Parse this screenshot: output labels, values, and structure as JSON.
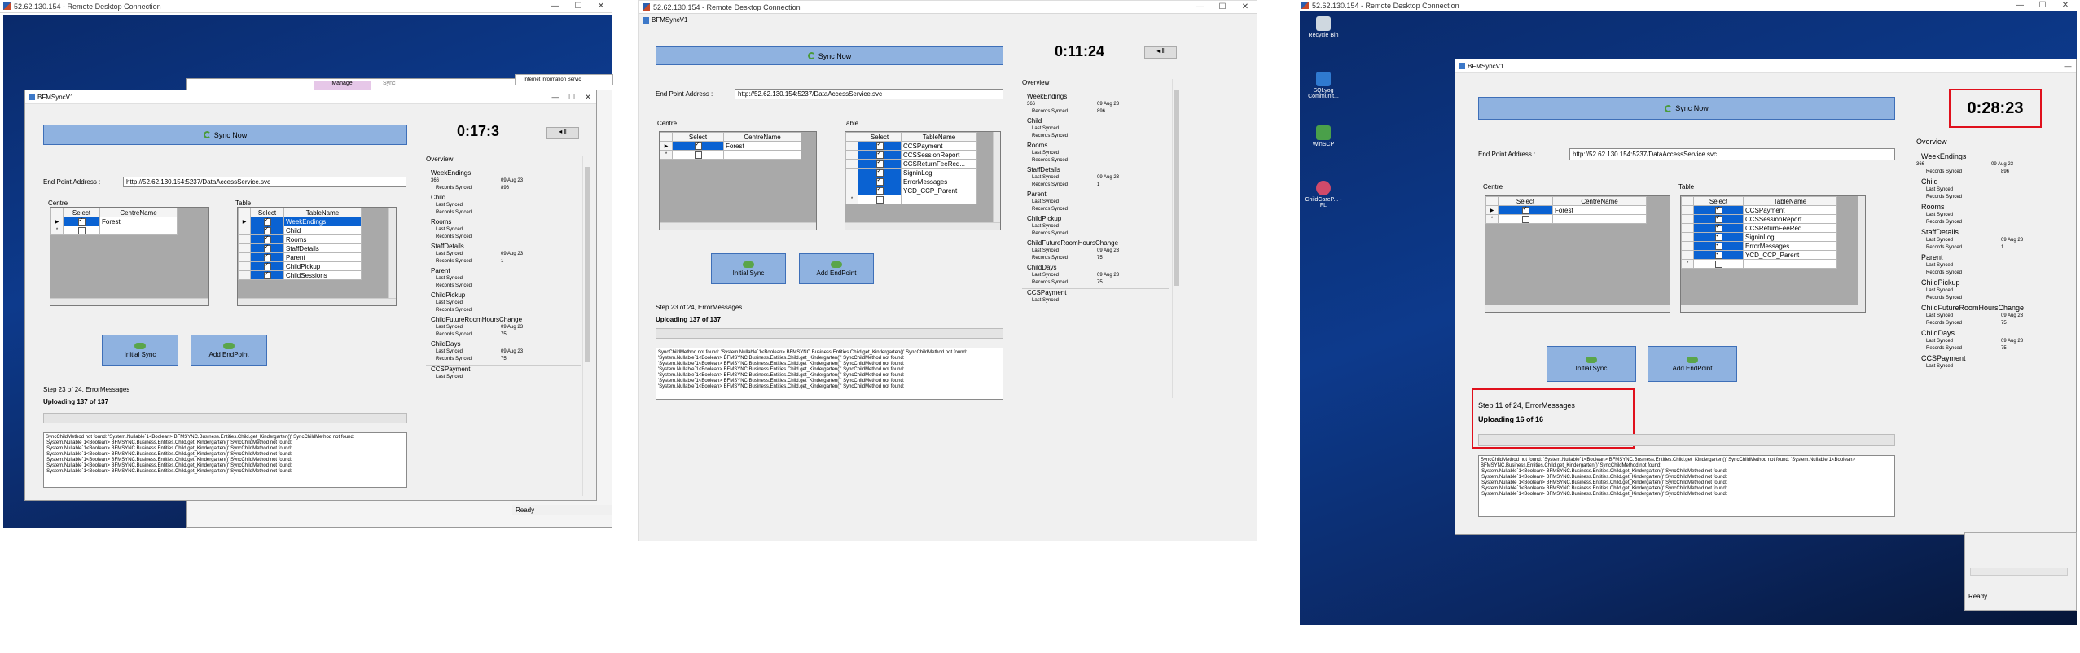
{
  "rdp_title": "52.62.130.154 - Remote Desktop Connection",
  "app_title": "BFMSyncV1",
  "sync_now": "Sync Now",
  "endpoint_label": "End Point Address :",
  "endpoint_url": "http://52.62.130.154:5237/DataAccessService.svc",
  "centre_label": "Centre",
  "table_label": "Table",
  "col_select": "Select",
  "col_centre_name": "CentreName",
  "col_table_name": "TableName",
  "centre_name": "Forest",
  "initial_sync": "Initial Sync",
  "add_endpoint": "Add EndPoint",
  "overview": "Overview",
  "last_synced": "Last Synced",
  "records_synced": "Records Synced",
  "ready": "Ready",
  "win1": {
    "timer": "0:17:3",
    "step": "Step 23 of 24, ErrorMessages",
    "uploading": "Uploading 137 of 137",
    "tables": [
      "WeekEndings",
      "Child",
      "Rooms",
      "StaffDetails",
      "Parent",
      "ChildPickup",
      "ChildSessions"
    ]
  },
  "win2": {
    "timer": "0:11:24",
    "step": "Step 23 of 24, ErrorMessages",
    "uploading": "Uploading 137 of 137",
    "tables": [
      "CCSPayment",
      "CCSSessionReport",
      "CCSReturnFeeRed...",
      "SigninLog",
      "ErrorMessages",
      "YCD_CCP_Parent"
    ]
  },
  "win3": {
    "timer": "0:28:23",
    "step": "Step 11 of 24, ErrorMessages",
    "uploading": "Uploading 16 of 16",
    "tables": [
      "CCSPayment",
      "CCSSessionReport",
      "CCSReturnFeeRed...",
      "SigninLog",
      "ErrorMessages",
      "YCD_CCP_Parent"
    ]
  },
  "overview_sections": {
    "weekendings": "WeekEndings",
    "child": "Child",
    "rooms": "Rooms",
    "staffdetails": "StaffDetails",
    "parent": "Parent",
    "childpickup": "ChildPickup",
    "childfuture": "ChildFutureRoomHoursChange",
    "childdays": "ChildDays",
    "ccspayment": "CCSPayment"
  },
  "overview_values": {
    "n366": "366",
    "date": "09 Aug 23",
    "v896": "896",
    "v1": "1",
    "v75": "75"
  },
  "log_lines": [
    "SyncChildMethod not found: 'System.Nullable`1<Boolean> BFMSYNC.Business.Entities.Child.get_Kindergarten()' SyncChildMethod not found: 'System.Nullable`1<Boolean> BFMSYNC.Business.Entities.Child.get_Kindergarten()' SyncChildMethod not found:",
    "'System.Nullable`1<Boolean> BFMSYNC.Business.Entities.Child.get_Kindergarten()' SyncChildMethod not found:",
    "'System.Nullable`1<Boolean> BFMSYNC.Business.Entities.Child.get_Kindergarten()' SyncChildMethod not found:",
    "'System.Nullable`1<Boolean> BFMSYNC.Business.Entities.Child.get_Kindergarten()' SyncChildMethod not found:",
    "'System.Nullable`1<Boolean> BFMSYNC.Business.Entities.Child.get_Kindergarten()' SyncChildMethod not found:",
    "'System.Nullable`1<Boolean> BFMSYNC.Business.Entities.Child.get_Kindergarten()' SyncChildMethod not found:"
  ],
  "desktop_icons": [
    "Recycle Bin",
    "SQLyog Communit...",
    "WinSCP",
    "ChildCareP... - FL"
  ],
  "bg_window": {
    "manage": "Manage",
    "sync": "Sync",
    "iis": "Internet Information Servic"
  }
}
